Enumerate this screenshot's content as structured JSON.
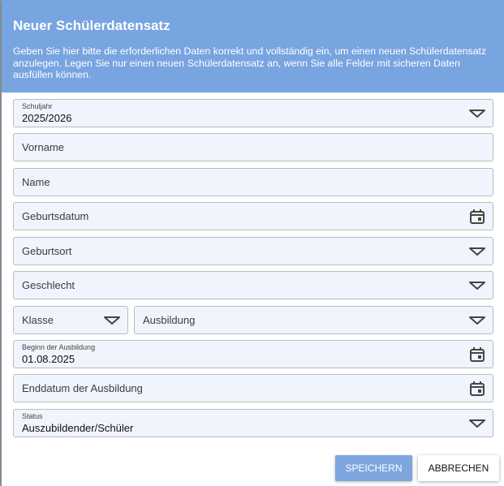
{
  "dialog": {
    "title": "Neuer Schülerdatensatz",
    "description": "Geben Sie hier bitte die erforderlichen Daten korrekt und vollständig ein, um einen neuen Schülerdatensatz anzulegen. Legen Sie nur einen neuen Schülerdatensatz an, wenn Sie alle Felder mit sicheren Daten ausfüllen können."
  },
  "form": {
    "schuljahr": {
      "label": "Schuljahr",
      "value": "2025/2026"
    },
    "vorname": {
      "placeholder": "Vorname"
    },
    "name": {
      "placeholder": "Name"
    },
    "geburtsdatum": {
      "placeholder": "Geburtsdatum"
    },
    "geburtsort": {
      "placeholder": "Geburtsort"
    },
    "geschlecht": {
      "placeholder": "Geschlecht"
    },
    "klasse": {
      "placeholder": "Klasse"
    },
    "ausbildung": {
      "placeholder": "Ausbildung"
    },
    "beginn": {
      "label": "Beginn der Ausbildung",
      "value": "01.08.2025"
    },
    "enddatum": {
      "placeholder": "Enddatum der Ausbildung"
    },
    "status": {
      "label": "Status",
      "value": "Auszubildender/Schüler"
    }
  },
  "buttons": {
    "save": "SPEICHERN",
    "cancel": "ABBRECHEN"
  },
  "colors": {
    "header_bg": "#78a4e0",
    "field_bg": "#f0f4fc",
    "save_bg": "#7fa6df"
  },
  "icons": {
    "dropdown": "chevron-down-icon",
    "date": "calendar-icon"
  }
}
